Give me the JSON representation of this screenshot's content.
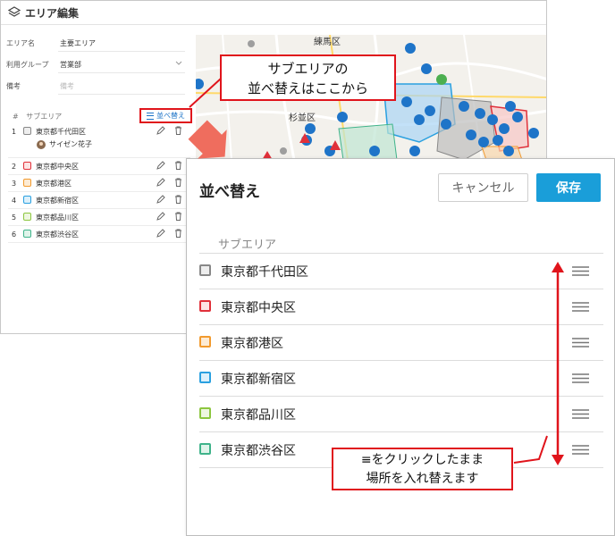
{
  "background_window": {
    "title": "エリア編集",
    "fields": [
      {
        "label": "エリア名",
        "value": "主要エリア"
      },
      {
        "label": "利用グループ",
        "value": "営業部"
      },
      {
        "label": "備考",
        "placeholder": "備考"
      }
    ],
    "subarea_header": {
      "hash": "#",
      "label": "サブエリア"
    },
    "sort_link_label": "並べ替え",
    "rows": [
      {
        "num": "1",
        "name": "東京都千代田区",
        "color": "#888888",
        "fill": "#eeeeee"
      },
      {
        "num": "2",
        "name": "東京都中央区",
        "color": "#e0303a",
        "fill": "#fde4e4"
      },
      {
        "num": "3",
        "name": "東京都港区",
        "color": "#f29a2e",
        "fill": "#fdebd4"
      },
      {
        "num": "4",
        "name": "東京都新宿区",
        "color": "#2aa0e0",
        "fill": "#dcf0fb"
      },
      {
        "num": "5",
        "name": "東京都品川区",
        "color": "#8cc63f",
        "fill": "#eef7df"
      },
      {
        "num": "6",
        "name": "東京都渋谷区",
        "color": "#3fb38a",
        "fill": "#dff4ea"
      }
    ],
    "person": "サイゼン花子",
    "map_labels": {
      "nerima": "練馬区",
      "suginami": "杉並区"
    }
  },
  "callout_top": {
    "line1": "サブエリアの",
    "line2": "並べ替えはここから"
  },
  "dialog": {
    "title": "並べ替え",
    "cancel": "キャンセル",
    "save": "保存",
    "list_header": "サブエリア",
    "rows": [
      {
        "name": "東京都千代田区",
        "color": "#888888",
        "fill": "#eeeeee"
      },
      {
        "name": "東京都中央区",
        "color": "#e0303a",
        "fill": "#fde4e4"
      },
      {
        "name": "東京都港区",
        "color": "#f29a2e",
        "fill": "#fdebd4"
      },
      {
        "name": "東京都新宿区",
        "color": "#2aa0e0",
        "fill": "#dcf0fb"
      },
      {
        "name": "東京都品川区",
        "color": "#8cc63f",
        "fill": "#eef7df"
      },
      {
        "name": "東京都渋谷区",
        "color": "#3fb38a",
        "fill": "#dff4ea"
      }
    ]
  },
  "callout_bottom": {
    "line1": "≡をクリックしたまま",
    "line2": "場所を入れ替えます"
  },
  "colors": {
    "accent_red": "#e0141b",
    "link_blue": "#1e74c8",
    "save_blue": "#1a9ed9"
  }
}
